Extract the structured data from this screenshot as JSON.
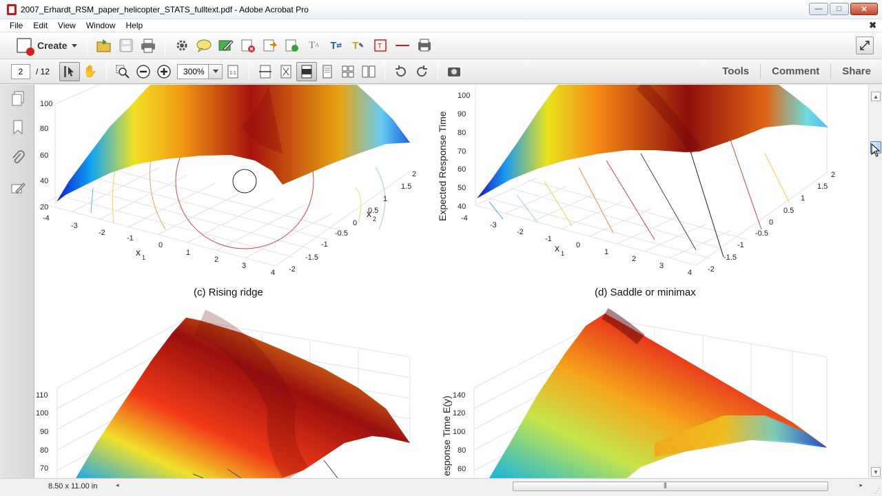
{
  "window": {
    "title": "2007_Erhardt_RSM_paper_helicopter_STATS_fulltext.pdf - Adobe Acrobat Pro",
    "minimize": "—",
    "maximize": "□",
    "close": "✕"
  },
  "menu": {
    "items": [
      "File",
      "Edit",
      "View",
      "Window",
      "Help"
    ],
    "close_doc": "✖"
  },
  "toolbar": {
    "create_label": "Create",
    "icons": [
      "open-folder-icon",
      "save-icon",
      "print-icon",
      "settings-icon",
      "comment-icon",
      "sign-icon",
      "redact-icon",
      "export-icon",
      "combine-icon",
      "typewriter-icon",
      "text-edit-icon",
      "highlight-icon",
      "textbox-icon",
      "strike-icon",
      "stamp-icon"
    ],
    "read_mode_icon": "expand-icon"
  },
  "nav_toolbar": {
    "current_page": "2",
    "total_pages": "/ 12",
    "zoom": "300%",
    "tabs": [
      "Tools",
      "Comment",
      "Share"
    ]
  },
  "document": {
    "caption_c": "(c) Rising ridge",
    "caption_d": "(d) Saddle or minimax",
    "plot_a": {
      "z_ticks": [
        "100",
        "80",
        "60",
        "40",
        "20"
      ],
      "x_ticks": [
        "-4",
        "-3",
        "-2",
        "-1",
        "0",
        "1",
        "2",
        "3",
        "4"
      ],
      "y_ticks": [
        "2",
        "1.5",
        "1",
        "0.5",
        "0",
        "-0.5",
        "-1",
        "-1.5",
        "-2"
      ],
      "x_label": "x",
      "x_sub": "1",
      "y_label": "x",
      "y_sub": "2"
    },
    "plot_b": {
      "z_label": "Expected Response Time",
      "z_ticks": [
        "100",
        "90",
        "80",
        "70",
        "60",
        "50",
        "40"
      ],
      "x_ticks": [
        "-4",
        "-3",
        "-2",
        "-1",
        "0",
        "1",
        "2",
        "3",
        "4"
      ],
      "y_ticks": [
        "2",
        "1.5",
        "1",
        "0.5",
        "0",
        "-0.5",
        "-1",
        "-1.5",
        "-2"
      ],
      "x_label": "x",
      "x_sub": "1"
    },
    "plot_c": {
      "z_ticks": [
        "110",
        "100",
        "90",
        "80",
        "70"
      ]
    },
    "plot_d": {
      "z_label": "esponse Time E(y)",
      "z_ticks": [
        "140",
        "120",
        "100",
        "80",
        "60"
      ]
    }
  },
  "status": {
    "page_size": "8.50 x 11.00 in"
  }
}
